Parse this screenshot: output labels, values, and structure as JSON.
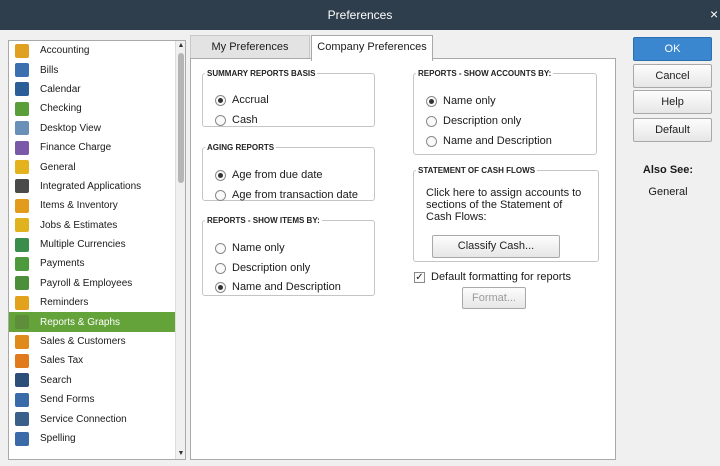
{
  "window": {
    "title": "Preferences",
    "close_glyph": "×"
  },
  "sidebar": {
    "selected_index": 14,
    "items": [
      {
        "label": "Accounting",
        "icon": "accounting-icon",
        "color": "#e0a020"
      },
      {
        "label": "Bills",
        "icon": "bills-icon",
        "color": "#3c6fb0"
      },
      {
        "label": "Calendar",
        "icon": "calendar-icon",
        "color": "#2b5d96"
      },
      {
        "label": "Checking",
        "icon": "checking-icon",
        "color": "#5a9e3a"
      },
      {
        "label": "Desktop View",
        "icon": "desktop-view-icon",
        "color": "#6a8fb8"
      },
      {
        "label": "Finance Charge",
        "icon": "finance-charge-icon",
        "color": "#7a59a8"
      },
      {
        "label": "General",
        "icon": "general-icon",
        "color": "#e3b21c"
      },
      {
        "label": "Integrated Applications",
        "icon": "integrated-applications-icon",
        "color": "#4a4a4a"
      },
      {
        "label": "Items & Inventory",
        "icon": "items-inventory-icon",
        "color": "#e39b1c"
      },
      {
        "label": "Jobs & Estimates",
        "icon": "jobs-estimates-icon",
        "color": "#e0b31e"
      },
      {
        "label": "Multiple Currencies",
        "icon": "multiple-currencies-icon",
        "color": "#3a8d4a"
      },
      {
        "label": "Payments",
        "icon": "payments-icon",
        "color": "#4d9a3c"
      },
      {
        "label": "Payroll & Employees",
        "icon": "payroll-employees-icon",
        "color": "#4c8f3a"
      },
      {
        "label": "Reminders",
        "icon": "reminders-icon",
        "color": "#e3a21c"
      },
      {
        "label": "Reports & Graphs",
        "icon": "reports-graphs-icon",
        "color": "#5f8e3a"
      },
      {
        "label": "Sales & Customers",
        "icon": "sales-customers-icon",
        "color": "#e08a1c"
      },
      {
        "label": "Sales Tax",
        "icon": "sales-tax-icon",
        "color": "#e07a1c"
      },
      {
        "label": "Search",
        "icon": "search-icon",
        "color": "#2c4f7a"
      },
      {
        "label": "Send Forms",
        "icon": "send-forms-icon",
        "color": "#3a6aa8"
      },
      {
        "label": "Service Connection",
        "icon": "service-connection-icon",
        "color": "#3a5f8a"
      },
      {
        "label": "Spelling",
        "icon": "spelling-icon",
        "color": "#3a6aa8"
      }
    ]
  },
  "tabs": {
    "my_preferences": "My Preferences",
    "company_preferences": "Company Preferences"
  },
  "summary_basis": {
    "legend": "SUMMARY REPORTS BASIS",
    "options": [
      "Accrual",
      "Cash"
    ],
    "selected": "Accrual"
  },
  "aging": {
    "legend": "AGING REPORTS",
    "options": [
      "Age from due date",
      "Age from transaction date"
    ],
    "selected": "Age from due date"
  },
  "items_by": {
    "legend": "REPORTS - SHOW ITEMS BY:",
    "options": [
      "Name only",
      "Description only",
      "Name and Description"
    ],
    "selected": "Name and Description"
  },
  "accounts_by": {
    "legend": "REPORTS -  SHOW ACCOUNTS BY:",
    "options": [
      "Name only",
      "Description only",
      "Name and Description"
    ],
    "selected": "Name only"
  },
  "cash_flows": {
    "legend": "STATEMENT OF CASH FLOWS",
    "text": "Click here to assign accounts to sections of the Statement of Cash Flows:",
    "button": "Classify Cash..."
  },
  "default_formatting": {
    "label": "Default formatting for reports",
    "checked": true,
    "check_glyph": "✓",
    "format_button": "Format..."
  },
  "actions": {
    "ok": "OK",
    "cancel": "Cancel",
    "help": "Help",
    "default": "Default"
  },
  "also_see": {
    "title": "Also See:",
    "items": [
      "General"
    ]
  },
  "colors": {
    "titlebar": "#2f3e4c",
    "selected_row": "#64a23a",
    "ok_button": "#3a87d0"
  }
}
